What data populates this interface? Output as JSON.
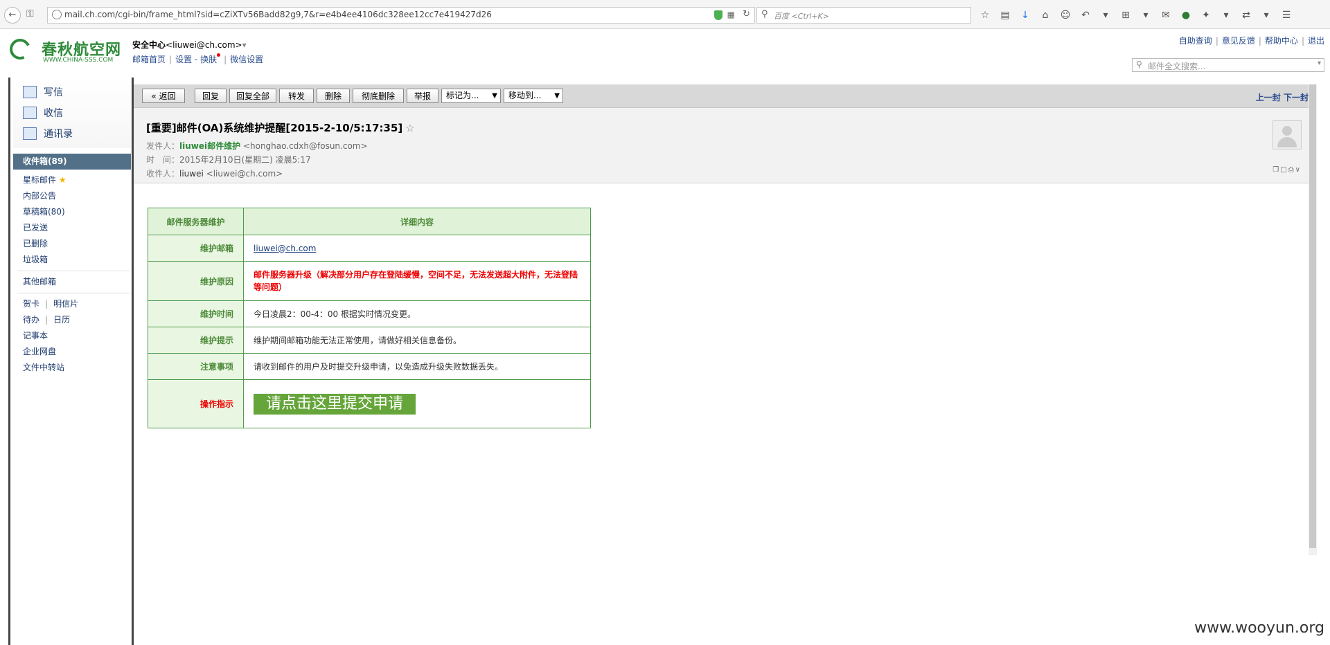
{
  "browser": {
    "url": "mail.ch.com/cgi-bin/frame_html?sid=cZiXTv56Badd82g9,7&r=e4b4ee4106dc328ee12cc7e419427d26",
    "search_placeholder": "百度 <Ctrl+K>"
  },
  "header": {
    "logo_name": "春秋航空网",
    "logo_site": "WWW.CHINA-SSS.COM",
    "security_center": "安全中心",
    "account": "<liuwei@ch.com>",
    "links": [
      "邮箱首页",
      "设置",
      "换肤",
      "微信设置"
    ],
    "link_sep": "-",
    "top_links": [
      "自助查询",
      "意见反馈",
      "帮助中心",
      "退出"
    ],
    "mail_search_placeholder": "邮件全文搜索..."
  },
  "sidebar": {
    "quick_actions": [
      {
        "label": "写信",
        "icon": "pencil-icon"
      },
      {
        "label": "收信",
        "icon": "inbox-download-icon"
      },
      {
        "label": "通讯录",
        "icon": "contacts-icon"
      }
    ],
    "inbox": "收件箱(89)",
    "starred": "星标邮件",
    "folders": [
      "内部公告",
      "草稿箱(80)",
      "已发送",
      "已删除",
      "垃圾箱"
    ],
    "other_mailboxes": "其他邮箱",
    "apps_row1": [
      "贺卡",
      "明信片"
    ],
    "apps_row2": [
      "待办",
      "日历"
    ],
    "apps": [
      "记事本",
      "企业网盘",
      "文件中转站"
    ]
  },
  "toolbar": {
    "back": "« 返回",
    "reply": "回复",
    "reply_all": "回复全部",
    "forward": "转发",
    "delete": "删除",
    "delete_permanent": "彻底删除",
    "report": "举报",
    "mark_as": "标记为...",
    "move_to": "移动到...",
    "prev": "上一封",
    "next": "下一封"
  },
  "mail": {
    "subject": "[重要]邮件(OA)系统维护提醒[2015-2-10/5:17:35]",
    "from_label": "发件人：",
    "from_name": "liuwei邮件维护",
    "from_addr": "<honghao.cdxh@fosun.com>",
    "time_label": "时　间：",
    "time": "2015年2月10日(星期二) 凌晨5:17",
    "to_label": "收件人：",
    "to_name": "liuwei",
    "to_addr": "<liuwei@ch.com>"
  },
  "table": {
    "header_left": "邮件服务器维护",
    "header_right": "详细内容",
    "rows": [
      {
        "label": "维护邮箱",
        "value": "liuwei@ch.com"
      },
      {
        "label": "维护原因",
        "value": "邮件服务器升级（解决部分用户存在登陆缓慢，空间不足，无法发送超大附件，无法登陆等问题）"
      },
      {
        "label": "维护时间",
        "value": "今日凌晨2：00-4：00 根据实时情况变更。"
      },
      {
        "label": "维护提示",
        "value": "维护期间邮箱功能无法正常使用，请做好相关信息备份。"
      },
      {
        "label": "注意事项",
        "value": "请收到邮件的用户及时提交升级申请，以免造成升级失败数据丢失。"
      },
      {
        "label": "操作指示",
        "value": "请点击这里提交申请"
      }
    ]
  },
  "watermark": "www.wooyun.org"
}
